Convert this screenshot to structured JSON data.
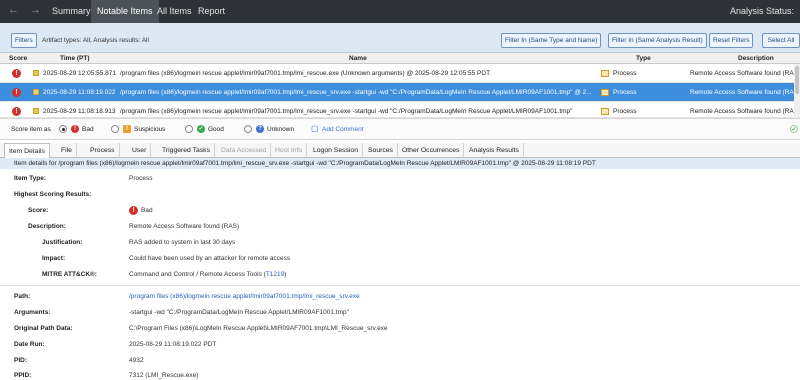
{
  "nav": {
    "tabs": [
      {
        "label": "Summary"
      },
      {
        "label": "Notable Items"
      },
      {
        "label": "All Items"
      },
      {
        "label": "Report"
      }
    ],
    "status": "Analysis Status:"
  },
  "filters": {
    "filters_button": "Filters",
    "description": "Artifact types: All, Analysis results: All",
    "filter_in_same_type": "Filter In (Same Type and Name)",
    "filter_in_same_result": "Filter In (Same Analysis Result)",
    "reset_filters": "Reset Filters",
    "select_all": "Select All"
  },
  "table": {
    "columns": {
      "score": "Score",
      "time": "Time (PT)",
      "name": "Name",
      "type": "Type",
      "description": "Description"
    },
    "rows": [
      {
        "time": "2025-08-29 12:05:55.871",
        "name": "/program files (x86)/logmein rescue applet/lmir09af7001.tmp/lmi_rescue.exe (Unknown arguments) @ 2025-08-29 12:05:55 PDT",
        "type": "Process",
        "description": "Remote Access Software found (RAS)"
      },
      {
        "time": "2025-08-29 11:08:19.022",
        "name": "/program files (x86)/logmein rescue applet/lmir09af7001.tmp/lmi_rescue_srv.exe -startgui -wd \"C:/ProgramData/LogMeIn Rescue Applet/LMIR09AF1001.tmp\" @ 2...",
        "type": "Process",
        "description": "Remote Access Software found (RAS)"
      },
      {
        "time": "2025-08-29 11:08:18.913",
        "name": "/program files (x86)/logmein rescue applet/lmir09af7001.tmp/lmi_rescue_srv.exe -startgui -wd \"C:/ProgramData/LogMeIn Rescue Applet/LMIR09AF1001.tmp\"",
        "type": "Process",
        "description": "Remote Access Software found (RAS)"
      }
    ]
  },
  "score_bar": {
    "label": "Score item as",
    "bad": "Bad",
    "suspicious": "Suspicious",
    "good": "Good",
    "unknown": "Unknown",
    "add_comment": "Add Comment"
  },
  "detail_tabs": [
    {
      "label": "Item Details"
    },
    {
      "label": "File"
    },
    {
      "label": "Process"
    },
    {
      "label": "User"
    },
    {
      "label": "Triggered Tasks"
    },
    {
      "label": "Data Accessed"
    },
    {
      "label": "Host Info"
    },
    {
      "label": "Logon Session"
    },
    {
      "label": "Sources"
    },
    {
      "label": "Other Occurrences"
    },
    {
      "label": "Analysis Results"
    }
  ],
  "details": {
    "header": "Item details for /program files (x86)/logmein rescue applet/lmir09af7001.tmp/lmi_rescue_srv.exe -startgui -wd \"C:/ProgramData/LogMeIn Rescue Applet/LMIR09AF1001.tmp\" @ 2025-08-29 11:08:19 PDT",
    "item_type_label": "Item Type:",
    "item_type": "Process",
    "highest_label": "Highest Scoring Results:",
    "score_label": "Score:",
    "score": "Bad",
    "description_label": "Description:",
    "description": "Remote Access Software found (RAS)",
    "justification_label": "Justification:",
    "justification": "RAS added to system in last 30 days",
    "impact_label": "Impact:",
    "impact": "Could have been used by an attacker for remote access",
    "mitre_label": "MITRE ATT&CK®:",
    "mitre": "Command and Control / Remote Access Tools (",
    "mitre_link": "T1219",
    "mitre_close": ")",
    "path_label": "Path:",
    "path": "/program files (x86)/logmein rescue applet/lmir09af7001.tmp/lmi_rescue_srv.exe",
    "arguments_label": "Arguments:",
    "arguments": "-startgui -wd \"C:/ProgramData/LogMeIn Rescue Applet/LMIR09AF1001.tmp\"",
    "orig_path_label": "Original Path Data:",
    "orig_path": "C:\\Program Files (x86)\\LogMeIn Rescue Applet\\LMIR09AF7001.tmp\\LMI_Rescue_srv.exe",
    "date_run_label": "Date Run:",
    "date_run": "2025-08-29 11:08:19.022 PDT",
    "pid_label": "PID:",
    "pid": "4932",
    "ppid_label": "PPID:",
    "ppid": "7312 (LMI_Rescue.exe)"
  }
}
